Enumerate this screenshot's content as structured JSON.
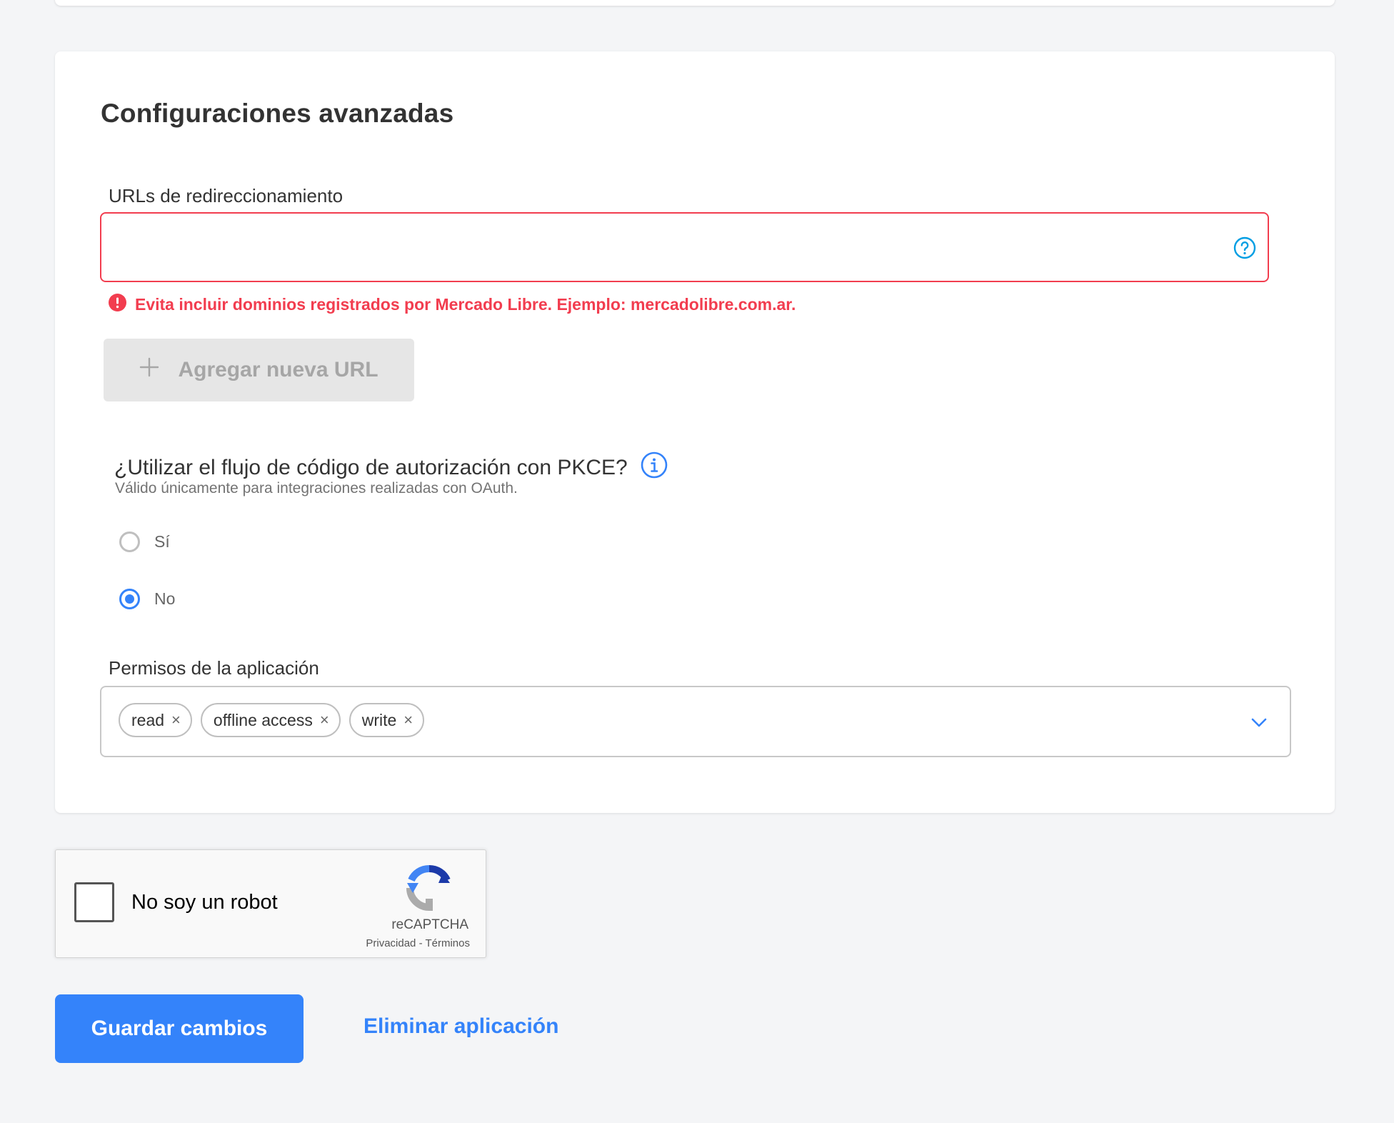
{
  "section": {
    "title": "Configuraciones avanzadas"
  },
  "redirect_urls": {
    "label": "URLs de redireccionamiento",
    "value": "",
    "placeholder": "",
    "help_icon": "question-circle-icon",
    "error_text": "Evita incluir dominios registrados por Mercado Libre. Ejemplo: mercadolibre.com.ar.",
    "error_color": "#f23d4f",
    "add_button_label": "Agregar nueva URL",
    "add_button_icon": "plus-icon"
  },
  "pkce": {
    "question": "¿Utilizar el flujo de código de autorización con PKCE?",
    "subtitle": "Válido únicamente para integraciones realizadas con OAuth.",
    "info_icon": "info-circle-icon",
    "options": [
      {
        "label": "Sí",
        "checked": false
      },
      {
        "label": "No",
        "checked": true
      }
    ]
  },
  "permissions": {
    "label": "Permisos de la aplicación",
    "chips": [
      "read",
      "offline access",
      "write"
    ],
    "remove_icon": "×",
    "dropdown_icon": "chevron-down-icon"
  },
  "captcha": {
    "label": "No soy un robot",
    "brand": "reCAPTCHA",
    "privacy": "Privacidad",
    "separator": "-",
    "terms": "Términos"
  },
  "actions": {
    "save_label": "Guardar cambios",
    "delete_label": "Eliminar aplicación"
  },
  "colors": {
    "accent": "#3483fa",
    "error": "#f23d4f",
    "background": "#f4f5f7"
  }
}
